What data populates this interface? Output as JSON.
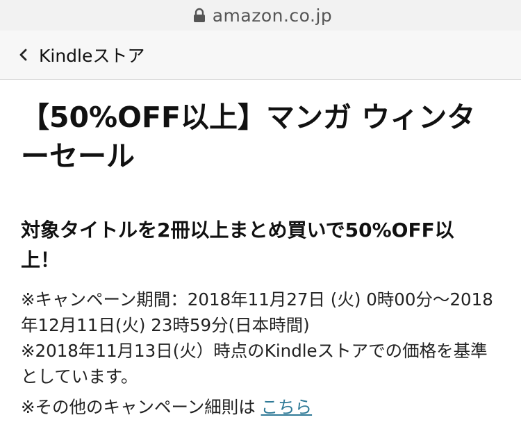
{
  "browser": {
    "url": "amazon.co.jp",
    "icons": {
      "lock": "lock-icon"
    }
  },
  "nav": {
    "back_label": "Kindleストア",
    "icons": {
      "back": "chevron-left-icon"
    }
  },
  "page": {
    "title": "【50%OFF以上】マンガ ウィンターセール",
    "subheading": "対象タイトルを2冊以上まとめ買いで50%OFF以上！",
    "notes": {
      "period": "※キャンペーン期間：2018年11月27日 (火) 0時00分～2018年12月11日(火) 23時59分(日本時間)",
      "price_basis": "※2018年11月13日(火）時点のKindleストアでの価格を基準としています。",
      "other_prefix": "※その他のキャンペーン細則は ",
      "other_link": "こちら"
    }
  },
  "colors": {
    "url_bar_bg": "#f2f2f2",
    "nav_bar_bg": "#f7f7f7",
    "link": "#2f7a97",
    "text": "#111111"
  }
}
